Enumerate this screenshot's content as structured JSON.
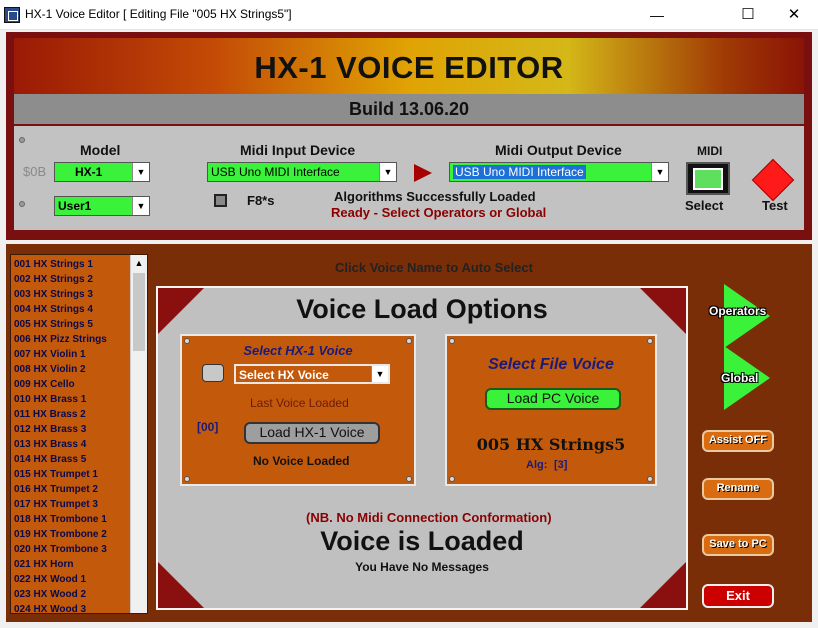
{
  "window": {
    "title": "HX-1 Voice Editor [ Editing File \"005 HX Strings5\"]",
    "min_glyph": "—",
    "max_glyph": "☐",
    "close_glyph": "✕"
  },
  "header": {
    "title": "HX-1 VOICE EDITOR",
    "build": "Build 13.06.20",
    "model_label": "Model",
    "model_address": "$0B",
    "model_value": "HX-1",
    "user_value": "User1",
    "midi_input_label": "Midi Input Device",
    "midi_input_value": "USB Uno MIDI Interface",
    "midi_output_label": "Midi Output Device",
    "midi_output_value": "USB Uno MIDI Interface",
    "f8_label": "F8*s",
    "status_line1": "Algorithms Successfully Loaded",
    "status_line2": "Ready - Select Operators or Global",
    "midi_label": "MIDI",
    "select_label": "Select",
    "test_label": "Test",
    "status_colors": {
      "ok": "#111111",
      "ready": "#8a0000"
    }
  },
  "voice_list": {
    "items": [
      "001 HX Strings 1",
      "002 HX Strings 2",
      "003 HX Strings 3",
      "004 HX Strings 4",
      "005 HX Strings 5",
      "006 HX Pizz Strings",
      "007 HX Violin 1",
      "008 HX Violin 2",
      "009 HX Cello",
      "010 HX Brass 1",
      "011 HX Brass 2",
      "012 HX Brass 3",
      "013 HX Brass 4",
      "014 HX Brass 5",
      "015 HX Trumpet 1",
      "016 HX Trumpet 2",
      "017 HX Trumpet 3",
      "018 HX Trombone 1",
      "019 HX Trombone 2",
      "020 HX Trombone 3",
      "021 HX Horn",
      "022 HX Wood 1",
      "023 HX Wood 2",
      "024 HX Wood 3"
    ]
  },
  "main": {
    "hint": "Click Voice Name to Auto Select",
    "title": "Voice Load Options",
    "hx_panel": {
      "title": "Select HX-1 Voice",
      "dropdown_value": "Select HX Voice",
      "last_loaded_label": "Last Voice Loaded",
      "index": "[00]",
      "load_button": "Load HX-1 Voice",
      "status": "No Voice Loaded"
    },
    "file_panel": {
      "title": "Select File Voice",
      "load_button": "Load PC Voice",
      "voice_name": "005 HX Strings5",
      "alg_label": "Alg:",
      "alg_value": "[3]"
    },
    "note": "(NB. No Midi Connection Conformation)",
    "loaded_text": "Voice is Loaded",
    "messages": "You Have No Messages"
  },
  "side": {
    "operators": "Operators",
    "global": "Global",
    "assist": "Assist OFF",
    "rename": "Rename",
    "save": "Save to PC",
    "exit": "Exit"
  }
}
